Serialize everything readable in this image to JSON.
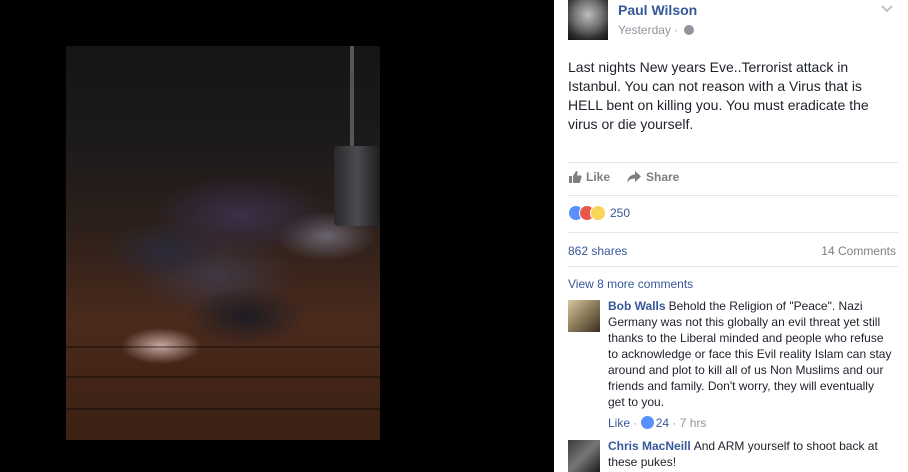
{
  "post": {
    "author": "Paul Wilson",
    "time": "Yesterday",
    "time_separator": "·",
    "text": "Last nights New years Eve..Terrorist attack in Istanbul. You can not reason with a Virus that is HELL bent on killing you. You must eradicate the virus or die yourself.",
    "actions": {
      "like": "Like",
      "share": "Share"
    },
    "reactions": {
      "count": "250",
      "types": [
        "like",
        "angry",
        "sad"
      ]
    },
    "shares": "862 shares",
    "comments_count": "14 Comments",
    "view_more": "View 8 more comments"
  },
  "comments": [
    {
      "author": "Bob Walls",
      "text": "Behold the Religion of \"Peace\". Nazi Germany was not this globally an evil threat yet still thanks to the Liberal minded and people who refuse to acknowledge or face this Evil reality Islam can stay around and plot to kill all of us Non Muslims and our friends and family. Don't worry, they will eventually get to you.",
      "like_label": "Like",
      "separator": "·",
      "likes": "24",
      "time": "7 hrs"
    },
    {
      "author": "Chris MacNeill",
      "text": "And ARM yourself to shoot back at these pukes!"
    }
  ],
  "colors": {
    "link": "#365899",
    "muted": "#90949c",
    "action": "#7f7f7f",
    "like_blue": "#5890ff"
  },
  "icons": [
    "globe-icon",
    "chevron-down-icon",
    "thumbs-up-icon",
    "share-arrow-icon",
    "like-reaction-icon",
    "angry-reaction-icon",
    "sad-reaction-icon"
  ]
}
